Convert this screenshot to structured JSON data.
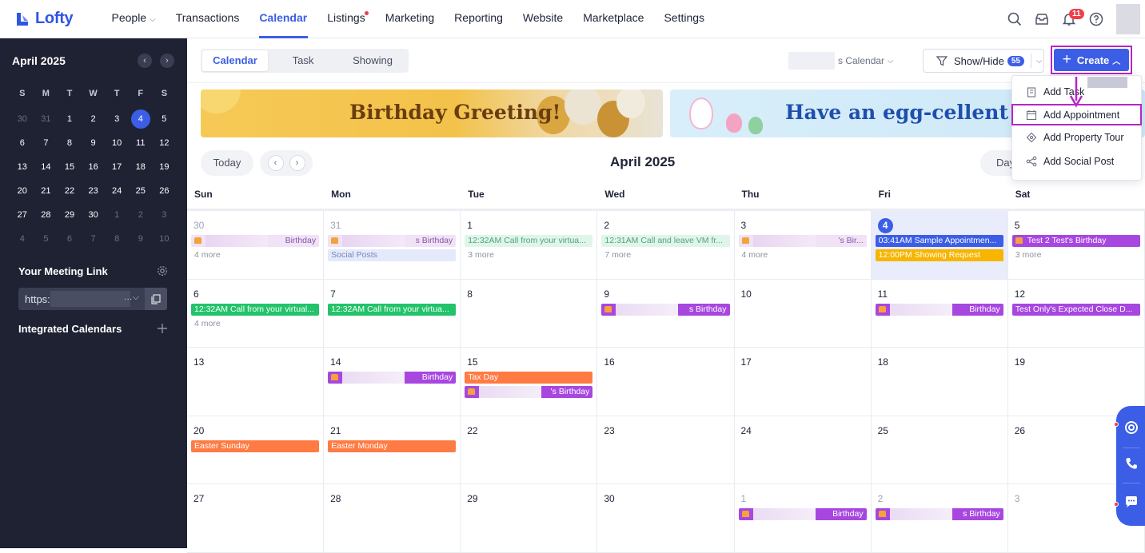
{
  "brand": {
    "name": "Lofty",
    "color": "#2f55e4"
  },
  "nav": {
    "items": [
      {
        "label": "People",
        "has_chevron": true
      },
      {
        "label": "Transactions"
      },
      {
        "label": "Calendar",
        "active": true
      },
      {
        "label": "Listings",
        "has_dot": true
      },
      {
        "label": "Marketing"
      },
      {
        "label": "Reporting"
      },
      {
        "label": "Website"
      },
      {
        "label": "Marketplace"
      },
      {
        "label": "Settings"
      }
    ],
    "notifications_count": "11"
  },
  "sidebar": {
    "month_title": "April 2025",
    "weekdays": [
      "S",
      "M",
      "T",
      "W",
      "T",
      "F",
      "S"
    ],
    "weeks": [
      [
        [
          "30",
          true
        ],
        [
          "31",
          true
        ],
        [
          "1",
          false
        ],
        [
          "2",
          false
        ],
        [
          "3",
          false
        ],
        [
          "4",
          false,
          true
        ],
        [
          "5",
          false
        ]
      ],
      [
        [
          "6",
          false
        ],
        [
          "7",
          false
        ],
        [
          "8",
          false
        ],
        [
          "9",
          false
        ],
        [
          "10",
          false
        ],
        [
          "11",
          false
        ],
        [
          "12",
          false
        ]
      ],
      [
        [
          "13",
          false
        ],
        [
          "14",
          false
        ],
        [
          "15",
          false
        ],
        [
          "16",
          false
        ],
        [
          "17",
          false
        ],
        [
          "18",
          false
        ],
        [
          "19",
          false
        ]
      ],
      [
        [
          "20",
          false
        ],
        [
          "21",
          false
        ],
        [
          "22",
          false
        ],
        [
          "23",
          false
        ],
        [
          "24",
          false
        ],
        [
          "25",
          false
        ],
        [
          "26",
          false
        ]
      ],
      [
        [
          "27",
          false
        ],
        [
          "28",
          false
        ],
        [
          "29",
          false
        ],
        [
          "30",
          false
        ],
        [
          "1",
          true
        ],
        [
          "2",
          true
        ],
        [
          "3",
          true
        ]
      ],
      [
        [
          "4",
          true
        ],
        [
          "5",
          true
        ],
        [
          "6",
          true
        ],
        [
          "7",
          true
        ],
        [
          "8",
          true
        ],
        [
          "9",
          true
        ],
        [
          "10",
          true
        ]
      ]
    ],
    "meeting_link_label": "Your Meeting Link",
    "meeting_link_value": "https:",
    "integrated_calendars_label": "Integrated Calendars"
  },
  "toolbar": {
    "tabs": [
      {
        "label": "Calendar",
        "active": true
      },
      {
        "label": "Task"
      },
      {
        "label": "Showing"
      }
    ],
    "calendar_select_label": "s Calendar",
    "show_hide_label": "Show/Hide",
    "show_hide_count": "55",
    "create_label": "Create"
  },
  "banners": {
    "birthday": "Birthday Greeting!",
    "easter": "Have an egg-cellent April!"
  },
  "calendar": {
    "today_label": "Today",
    "month_title": "April 2025",
    "view_label": "Day",
    "weekdays": [
      "Sun",
      "Mon",
      "Tue",
      "Wed",
      "Thu",
      "Fri",
      "Sat"
    ],
    "weeks": [
      [
        {
          "d": "30",
          "muted": true,
          "events": [
            {
              "t": "Birthday",
              "c": "bday-light",
              "cake": true,
              "blur": true
            }
          ],
          "more": "4 more"
        },
        {
          "d": "31",
          "muted": true,
          "events": [
            {
              "t": "s Birthday",
              "c": "bday-light",
              "cake": true,
              "blur": true
            },
            {
              "t": "Social Posts",
              "c": "lav"
            }
          ]
        },
        {
          "d": "1",
          "events": [
            {
              "t": "12:32AM Call from your virtua...",
              "c": "green-light"
            }
          ],
          "more": "3 more"
        },
        {
          "d": "2",
          "events": [
            {
              "t": "12:31AM Call and leave VM fr...",
              "c": "green-light"
            }
          ],
          "more": "7 more"
        },
        {
          "d": "3",
          "events": [
            {
              "t": "'s Bir...",
              "c": "bday-light",
              "cake": true,
              "blur": true
            }
          ],
          "more": "4 more"
        },
        {
          "d": "4",
          "today": true,
          "events": [
            {
              "t": "03:41AM Sample Appointmen...",
              "c": "blue"
            },
            {
              "t": "12:00PM Showing Request",
              "c": "amber"
            }
          ]
        },
        {
          "d": "5",
          "events": [
            {
              "t": "Test 2 Test's Birthday",
              "c": "bday",
              "cake": true
            }
          ],
          "more": "3 more"
        }
      ],
      [
        {
          "d": "6",
          "events": [
            {
              "t": "12:32AM Call from your virtual...",
              "c": "green"
            }
          ],
          "more": "4 more"
        },
        {
          "d": "7",
          "events": [
            {
              "t": "12:32AM Call from your virtua...",
              "c": "green"
            }
          ]
        },
        {
          "d": "8",
          "events": []
        },
        {
          "d": "9",
          "events": [
            {
              "t": "s Birthday",
              "c": "bday",
              "cake": true,
              "blur": true
            }
          ]
        },
        {
          "d": "10",
          "events": []
        },
        {
          "d": "11",
          "events": [
            {
              "t": "Birthday",
              "c": "bday",
              "cake": true,
              "blur": true
            }
          ]
        },
        {
          "d": "12",
          "events": [
            {
              "t": "Test Only's Expected Close D...",
              "c": "bday"
            }
          ]
        }
      ],
      [
        {
          "d": "13",
          "events": []
        },
        {
          "d": "14",
          "events": [
            {
              "t": "Birthday",
              "c": "bday",
              "cake": true,
              "blur": true
            }
          ]
        },
        {
          "d": "15",
          "events": [
            {
              "t": "Tax Day",
              "c": "orange"
            },
            {
              "t": "'s Birthday",
              "c": "bday",
              "cake": true,
              "blur": true
            }
          ]
        },
        {
          "d": "16",
          "events": []
        },
        {
          "d": "17",
          "events": []
        },
        {
          "d": "18",
          "events": []
        },
        {
          "d": "19",
          "events": []
        }
      ],
      [
        {
          "d": "20",
          "events": [
            {
              "t": "Easter Sunday",
              "c": "orange"
            }
          ]
        },
        {
          "d": "21",
          "events": [
            {
              "t": "Easter Monday",
              "c": "orange"
            }
          ]
        },
        {
          "d": "22",
          "events": []
        },
        {
          "d": "23",
          "events": []
        },
        {
          "d": "24",
          "events": []
        },
        {
          "d": "25",
          "events": []
        },
        {
          "d": "26",
          "events": []
        }
      ],
      [
        {
          "d": "27",
          "events": []
        },
        {
          "d": "28",
          "events": []
        },
        {
          "d": "29",
          "events": []
        },
        {
          "d": "30",
          "events": []
        },
        {
          "d": "1",
          "muted": true,
          "events": [
            {
              "t": "Birthday",
              "c": "bday",
              "cake": true,
              "blur": true
            }
          ]
        },
        {
          "d": "2",
          "muted": true,
          "events": [
            {
              "t": "s Birthday",
              "c": "bday",
              "cake": true,
              "blur": true
            }
          ]
        },
        {
          "d": "3",
          "muted": true,
          "events": []
        }
      ]
    ]
  },
  "create_menu": {
    "items": [
      {
        "label": "Add Task",
        "icon": "clipboard-icon"
      },
      {
        "label": "Add Appointment",
        "icon": "calendar-icon",
        "highlighted": true
      },
      {
        "label": "Add Property Tour",
        "icon": "map-pin-icon"
      },
      {
        "label": "Add Social Post",
        "icon": "share-icon"
      }
    ]
  },
  "colors": {
    "accent": "#3c5ee6",
    "sidebar_bg": "#1f2233",
    "annotation": "#b726c9",
    "birthday": "#a747e0",
    "call": "#22c36a",
    "holiday": "#ff7b44",
    "showing": "#f7b500"
  }
}
